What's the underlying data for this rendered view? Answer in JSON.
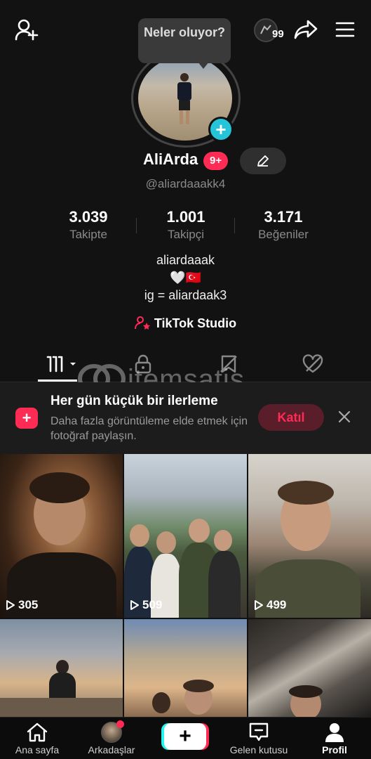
{
  "header": {
    "notification_count": "99",
    "bubble_text": "Neler oluyor?"
  },
  "profile": {
    "display_name": "AliArda",
    "badge": "9+",
    "username": "@aliardaaakk4",
    "stats": [
      {
        "value": "3.039",
        "label": "Takipte"
      },
      {
        "value": "1.001",
        "label": "Takipçi"
      },
      {
        "value": "3.171",
        "label": "Beğeniler"
      }
    ],
    "bio_lines": [
      "aliardaaak",
      "🤍🇹🇷",
      "ig = aliardaak3"
    ],
    "studio_label": "TikTok Studio"
  },
  "watermark": {
    "text": "itemsatis"
  },
  "banner": {
    "title": "Her gün küçük bir ilerleme",
    "text": "Daha fazla görüntüleme elde etmek için fotoğraf paylaşın.",
    "join_label": "Katıl"
  },
  "videos": [
    {
      "views": "305"
    },
    {
      "views": "509"
    },
    {
      "views": "499"
    },
    {
      "views": ""
    },
    {
      "views": ""
    },
    {
      "views": ""
    }
  ],
  "nav": {
    "items": [
      {
        "label": "Ana sayfa",
        "icon": "home-icon"
      },
      {
        "label": "Arkadaşlar",
        "icon": "friends-avatar"
      },
      {
        "label": "",
        "icon": "create-icon"
      },
      {
        "label": "Gelen kutusu",
        "icon": "inbox-icon"
      },
      {
        "label": "Profil",
        "icon": "profile-icon"
      }
    ]
  },
  "colors": {
    "accent": "#fe2c55",
    "cyan": "#25c4d9",
    "background": "#121212"
  }
}
